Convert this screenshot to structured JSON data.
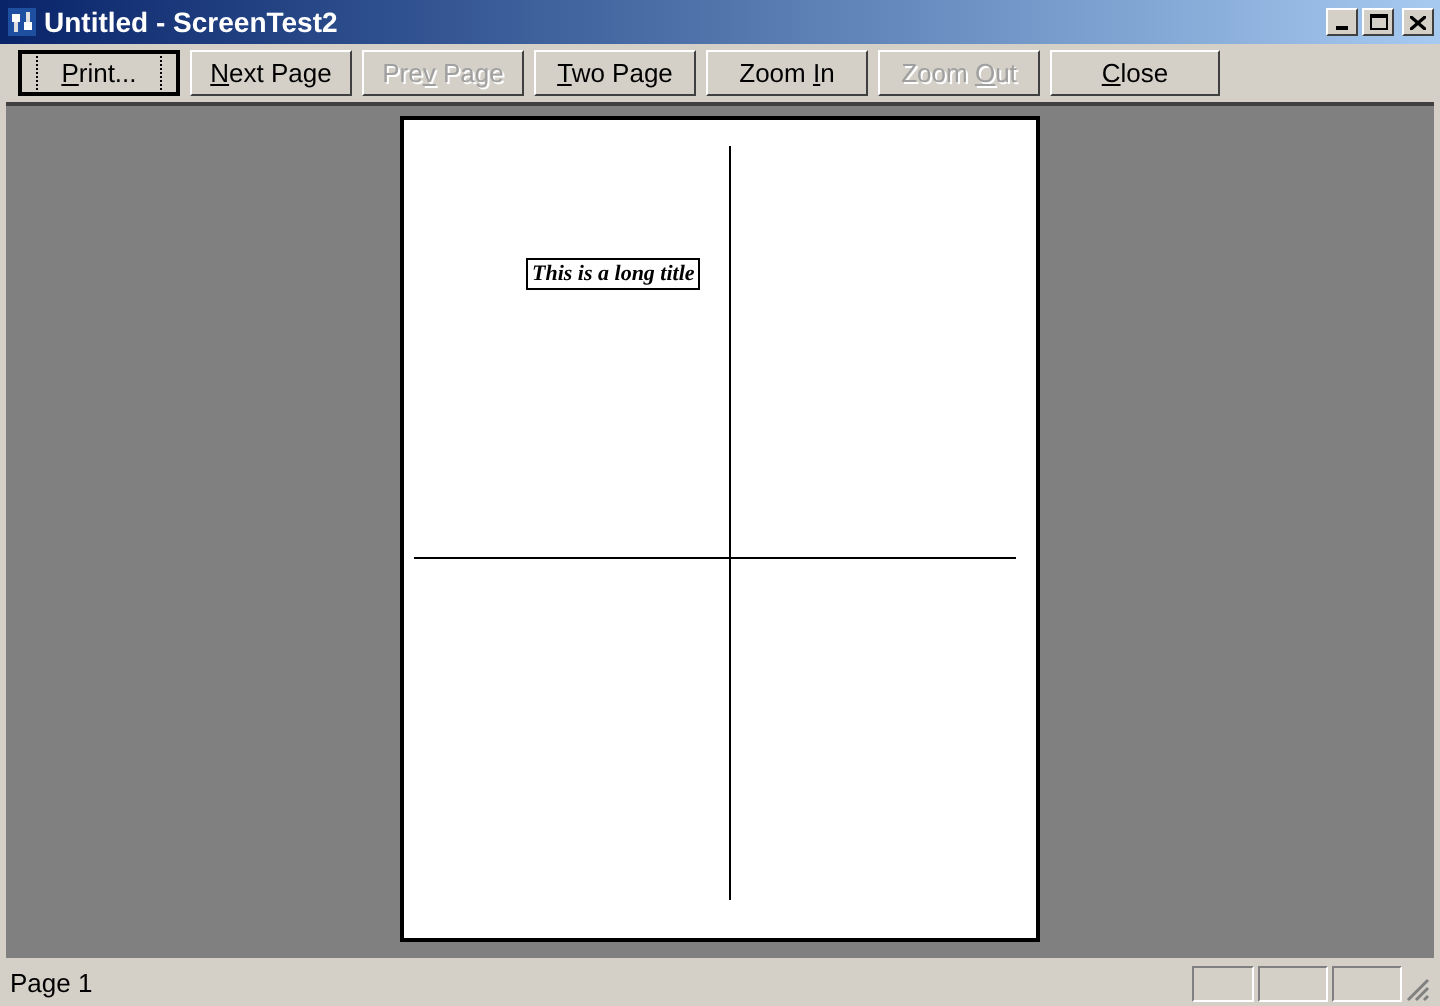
{
  "window": {
    "title": "Untitled - ScreenTest2"
  },
  "toolbar": [
    {
      "access_key": "P",
      "after": "rint...",
      "default": true,
      "disabled": false
    },
    {
      "access_key": "N",
      "after": "ext Page",
      "default": false,
      "disabled": false
    },
    {
      "before": "Pre",
      "access_key": "v",
      "after": " Page",
      "default": false,
      "disabled": true
    },
    {
      "access_key": "T",
      "after": "wo Page",
      "default": false,
      "disabled": false
    },
    {
      "before": "Zoom ",
      "access_key": "I",
      "after": "n",
      "default": false,
      "disabled": false
    },
    {
      "before": "Zoom ",
      "access_key": "O",
      "after": "ut",
      "default": false,
      "disabled": true
    },
    {
      "access_key": "C",
      "after": "lose",
      "default": false,
      "disabled": false
    }
  ],
  "preview_page": {
    "title": "This is a long title"
  },
  "status_bar": {
    "text": "Page 1"
  }
}
